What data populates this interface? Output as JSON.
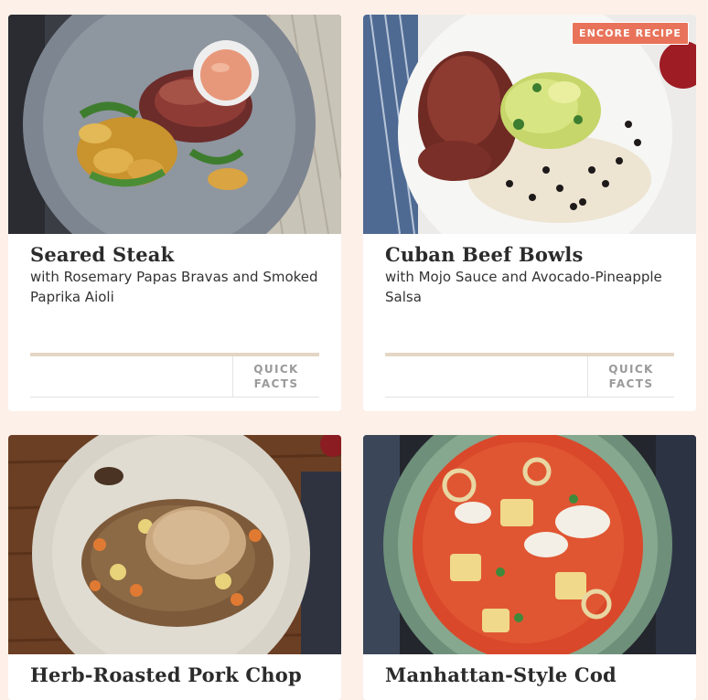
{
  "recipes": [
    {
      "title": "Seared Steak",
      "subtitle": "with Rosemary Papas Bravas and Smoked Paprika Aioli",
      "quick_facts_line1": "QUICK",
      "quick_facts_line2": "FACTS"
    },
    {
      "title": "Cuban Beef Bowls",
      "subtitle": "with Mojo Sauce and Avocado-Pineapple Salsa",
      "badge": "ENCORE RECIPE",
      "quick_facts_line1": "QUICK",
      "quick_facts_line2": "FACTS"
    },
    {
      "title": "Herb-Roasted Pork Chop"
    },
    {
      "title": "Manhattan-Style Cod"
    }
  ],
  "colors": {
    "page_background": "#fdf0e8",
    "card_background": "#ffffff",
    "badge_background": "#e8735a",
    "divider": "#e4d6c4",
    "title_text": "#2b2b2b",
    "muted_text": "#9a9a9a"
  }
}
